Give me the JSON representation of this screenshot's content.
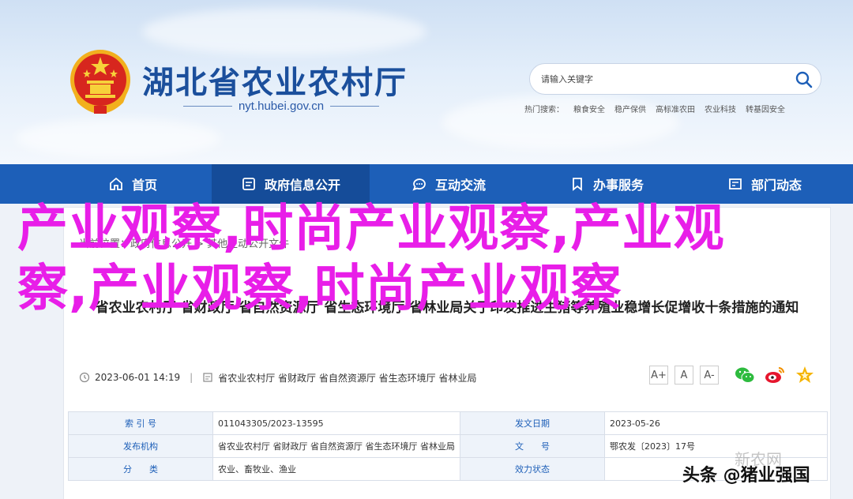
{
  "header": {
    "site_title": "湖北省农业农村厅",
    "site_domain": "nyt.hubei.gov.cn",
    "search_placeholder": "请输入关键字",
    "hot_label": "热门搜索：",
    "hot_keywords": [
      "粮食安全",
      "稳产保供",
      "高标准农田",
      "农业科技",
      "转基因安全"
    ]
  },
  "nav": {
    "items": [
      {
        "label": "首页",
        "icon": "home-icon"
      },
      {
        "label": "政府信息公开",
        "icon": "document-icon"
      },
      {
        "label": "互动交流",
        "icon": "chat-icon"
      },
      {
        "label": "办事服务",
        "icon": "bookmark-icon"
      },
      {
        "label": "部门动态",
        "icon": "news-icon"
      }
    ],
    "active_index": 1
  },
  "article": {
    "breadcrumb": "当前位置：政府信息公开 > 其他主动公开文件",
    "title": "省农业农村厅 省财政厅 省自然资源厅 省生态环境厅 省林业局关于印发推进生猪等养殖业稳增长促增收十条措施的通知",
    "date": "2023-06-01 14:19",
    "sources": "省农业农村厅 省财政厅 省自然资源厅 省生态环境厅 省林业局",
    "font_buttons": [
      "A+",
      "A",
      "A-"
    ]
  },
  "info_table": {
    "rows": [
      [
        "索 引 号",
        "011043305/2023-13595",
        "发文日期",
        "2023-05-26"
      ],
      [
        "发布机构",
        "省农业农村厅 省财政厅 省自然资源厅 省生态环境厅 省林业局",
        "文　　号",
        "鄂农发〔2023〕17号"
      ],
      [
        "分　　类",
        "农业、畜牧业、渔业",
        "效力状态",
        ""
      ]
    ]
  },
  "overlay": {
    "title": "产业观察,时尚产业观察,产业观察,产业观察,时尚产业观察",
    "watermark": "新农网",
    "source_tag": "头条 @猪业强国"
  },
  "colors": {
    "primary_blue": "#1d5fb8",
    "overlay_magenta": "#e81ee8"
  }
}
